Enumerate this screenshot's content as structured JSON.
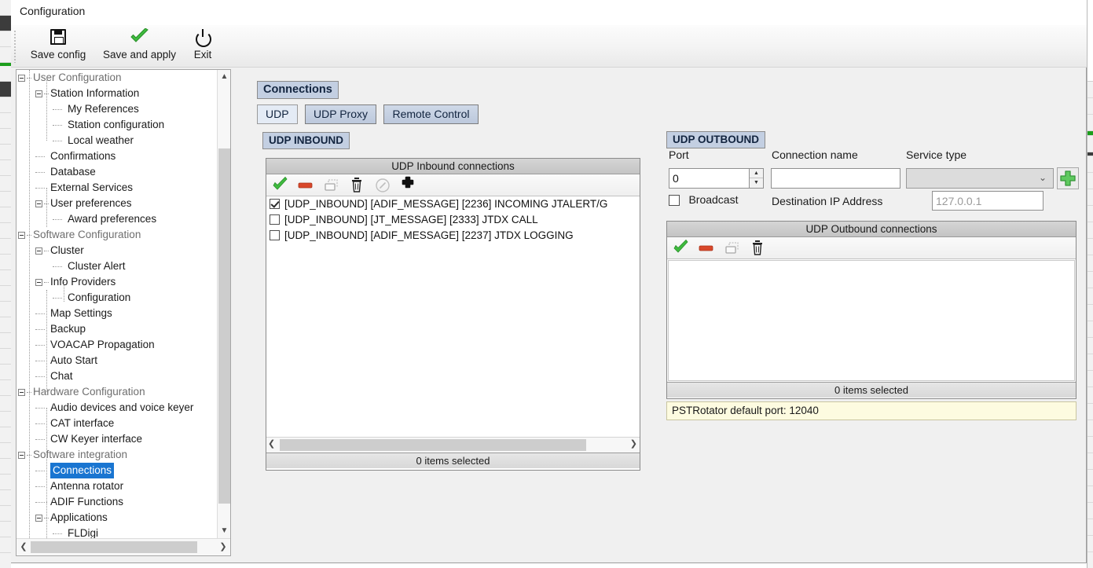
{
  "window": {
    "title": "Configuration"
  },
  "toolbar": {
    "buttons": [
      {
        "label": "Save config",
        "icon": "floppy-disk-icon"
      },
      {
        "label": "Save and apply",
        "icon": "green-check-icon"
      },
      {
        "label": "Exit",
        "icon": "power-icon"
      }
    ]
  },
  "sidebar": {
    "items": [
      {
        "label": "User Configuration",
        "depth": 0,
        "expander": true,
        "group": true
      },
      {
        "label": "Station Information",
        "depth": 1,
        "expander": true,
        "group": false
      },
      {
        "label": "My References",
        "depth": 2,
        "expander": false,
        "group": false
      },
      {
        "label": "Station configuration",
        "depth": 2,
        "expander": false,
        "group": false
      },
      {
        "label": "Local weather",
        "depth": 2,
        "expander": false,
        "group": false
      },
      {
        "label": "Confirmations",
        "depth": 1,
        "expander": false,
        "group": false
      },
      {
        "label": "Database",
        "depth": 1,
        "expander": false,
        "group": false
      },
      {
        "label": "External Services",
        "depth": 1,
        "expander": false,
        "group": false
      },
      {
        "label": "User preferences",
        "depth": 1,
        "expander": true,
        "group": false
      },
      {
        "label": "Award preferences",
        "depth": 2,
        "expander": false,
        "group": false
      },
      {
        "label": "Software Configuration",
        "depth": 0,
        "expander": true,
        "group": true
      },
      {
        "label": "Cluster",
        "depth": 1,
        "expander": true,
        "group": false
      },
      {
        "label": "Cluster Alert",
        "depth": 2,
        "expander": false,
        "group": false
      },
      {
        "label": "Info Providers",
        "depth": 1,
        "expander": true,
        "group": false
      },
      {
        "label": "Configuration",
        "depth": 2,
        "expander": false,
        "group": false
      },
      {
        "label": "Map Settings",
        "depth": 1,
        "expander": false,
        "group": false
      },
      {
        "label": "Backup",
        "depth": 1,
        "expander": false,
        "group": false
      },
      {
        "label": "VOACAP Propagation",
        "depth": 1,
        "expander": false,
        "group": false
      },
      {
        "label": "Auto Start",
        "depth": 1,
        "expander": false,
        "group": false
      },
      {
        "label": "Chat",
        "depth": 1,
        "expander": false,
        "group": false
      },
      {
        "label": "Hardware Configuration",
        "depth": 0,
        "expander": true,
        "group": true
      },
      {
        "label": "Audio devices and voice keyer",
        "depth": 1,
        "expander": false,
        "group": false
      },
      {
        "label": "CAT interface",
        "depth": 1,
        "expander": false,
        "group": false
      },
      {
        "label": "CW Keyer interface",
        "depth": 1,
        "expander": false,
        "group": false
      },
      {
        "label": "Software integration",
        "depth": 0,
        "expander": true,
        "group": true
      },
      {
        "label": "Connections",
        "depth": 1,
        "expander": false,
        "group": false,
        "selected": true
      },
      {
        "label": "Antenna rotator",
        "depth": 1,
        "expander": false,
        "group": false
      },
      {
        "label": "ADIF Functions",
        "depth": 1,
        "expander": false,
        "group": false
      },
      {
        "label": "Applications",
        "depth": 1,
        "expander": true,
        "group": false
      },
      {
        "label": "FLDigi",
        "depth": 2,
        "expander": false,
        "group": false
      }
    ]
  },
  "main": {
    "panel_title": "Connections",
    "tabs": [
      {
        "label": "UDP",
        "active": true
      },
      {
        "label": "UDP Proxy",
        "active": false
      },
      {
        "label": "Remote Control",
        "active": false
      }
    ],
    "inbound": {
      "section_label": "UDP INBOUND",
      "list_header": "UDP Inbound connections",
      "tools": [
        {
          "name": "enable-icon",
          "glyph": "check"
        },
        {
          "name": "disable-icon",
          "glyph": "minus"
        },
        {
          "name": "duplicate-icon",
          "glyph": "copy"
        },
        {
          "name": "delete-icon",
          "glyph": "trash"
        },
        {
          "name": "edit-icon",
          "glyph": "pencil"
        },
        {
          "name": "add-icon",
          "glyph": "plus"
        }
      ],
      "rows": [
        {
          "checked": true,
          "text": "[UDP_INBOUND] [ADIF_MESSAGE] [2236] INCOMING JTALERT/G"
        },
        {
          "checked": false,
          "text": "[UDP_INBOUND] [JT_MESSAGE] [2333] JTDX CALL"
        },
        {
          "checked": false,
          "text": "[UDP_INBOUND] [ADIF_MESSAGE] [2237] JTDX LOGGING"
        }
      ],
      "status": "0 items selected"
    },
    "outbound": {
      "section_label": "UDP OUTBOUND",
      "port_label": "Port",
      "port_value": "0",
      "connection_name_label": "Connection name",
      "connection_name_value": "",
      "service_type_label": "Service type",
      "service_type_value": "",
      "add_button": "add-outbound-icon",
      "broadcast_label": "Broadcast",
      "broadcast_checked": false,
      "dest_ip_label": "Destination IP Address",
      "dest_ip_value": "127.0.0.1",
      "list_header": "UDP Outbound connections",
      "tools": [
        {
          "name": "enable-icon",
          "glyph": "check"
        },
        {
          "name": "disable-icon",
          "glyph": "minus"
        },
        {
          "name": "duplicate-icon",
          "glyph": "copy"
        },
        {
          "name": "delete-icon",
          "glyph": "trash"
        }
      ],
      "rows": [],
      "status": "0 items selected",
      "hint": "PSTRotator default port: 12040"
    }
  },
  "colors": {
    "accent_blue": "#1975d1",
    "panel_header": "#c3cfe2",
    "hint_yellow": "#fdfbe0",
    "green": "#2fae2f",
    "red": "#d9482b"
  }
}
